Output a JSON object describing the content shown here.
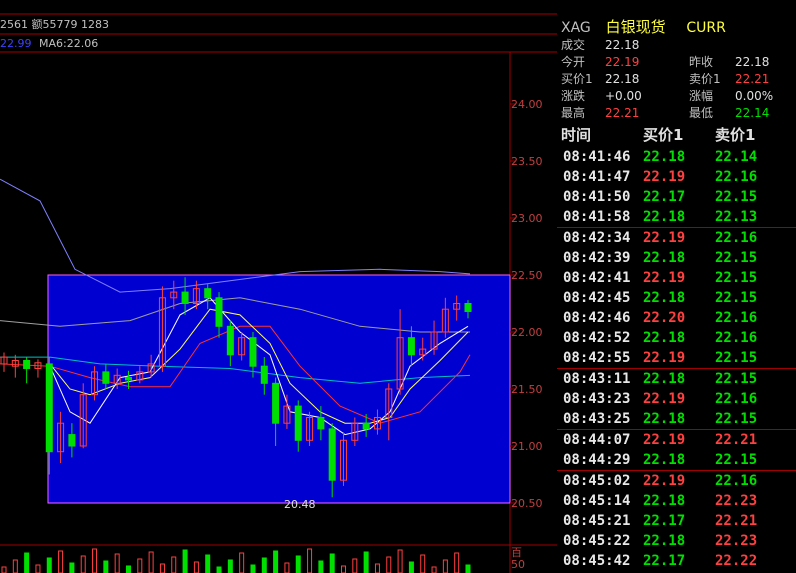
{
  "top_info": "2561 额55779 1283",
  "ma": {
    "ma5_label": "22.99",
    "ma6_label": "MA6:22.06"
  },
  "price_axis": [
    "24.00",
    "23.50",
    "23.00",
    "22.50",
    "22.00",
    "21.50",
    "21.00",
    "20.50"
  ],
  "low_marker": "20.48",
  "volume_axis": {
    "unit_label": "百",
    "value": "50"
  },
  "header": {
    "code": "XAG",
    "name": "白银现货",
    "tag": "CURR"
  },
  "quote": {
    "rows": [
      {
        "l1": "成交",
        "v1": "22.18",
        "c1": "w"
      },
      {
        "l1": "今开",
        "v1": "22.19",
        "c1": "r",
        "l2": "昨收",
        "v2": "22.18",
        "c2": "w"
      },
      {
        "l1": "买价1",
        "v1": "22.18",
        "c1": "w",
        "l2": "卖价1",
        "v2": "22.21",
        "c2": "r"
      },
      {
        "l1": "涨跌",
        "v1": "+0.00",
        "c1": "w",
        "l2": "涨幅",
        "v2": "0.00%",
        "c2": "w"
      },
      {
        "l1": "最高",
        "v1": "22.21",
        "c1": "r",
        "l2": "最低",
        "v2": "22.14",
        "c2": "g"
      }
    ]
  },
  "ticks_header": {
    "time": "时间",
    "bid": "买价1",
    "ask": "卖价1"
  },
  "ticks": [
    {
      "t": "08:41:46",
      "b": "22.18",
      "bc": "g",
      "s": "22.14",
      "sc": "g"
    },
    {
      "t": "08:41:47",
      "b": "22.19",
      "bc": "r",
      "s": "22.16",
      "sc": "g"
    },
    {
      "t": "08:41:50",
      "b": "22.17",
      "bc": "g",
      "s": "22.15",
      "sc": "g"
    },
    {
      "t": "08:41:58",
      "b": "22.18",
      "bc": "g",
      "s": "22.13",
      "sc": "g",
      "sep": true
    },
    {
      "t": "08:42:34",
      "b": "22.19",
      "bc": "r",
      "s": "22.16",
      "sc": "g"
    },
    {
      "t": "08:42:39",
      "b": "22.18",
      "bc": "g",
      "s": "22.15",
      "sc": "g"
    },
    {
      "t": "08:42:41",
      "b": "22.19",
      "bc": "r",
      "s": "22.15",
      "sc": "g"
    },
    {
      "t": "08:42:45",
      "b": "22.18",
      "bc": "g",
      "s": "22.15",
      "sc": "g"
    },
    {
      "t": "08:42:46",
      "b": "22.20",
      "bc": "r",
      "s": "22.16",
      "sc": "g"
    },
    {
      "t": "08:42:52",
      "b": "22.18",
      "bc": "g",
      "s": "22.16",
      "sc": "g"
    },
    {
      "t": "08:42:55",
      "b": "22.19",
      "bc": "r",
      "s": "22.15",
      "sc": "g",
      "sep": true
    },
    {
      "t": "08:43:11",
      "b": "22.18",
      "bc": "g",
      "s": "22.15",
      "sc": "g"
    },
    {
      "t": "08:43:23",
      "b": "22.19",
      "bc": "r",
      "s": "22.16",
      "sc": "g"
    },
    {
      "t": "08:43:25",
      "b": "22.18",
      "bc": "g",
      "s": "22.15",
      "sc": "g",
      "sep": true
    },
    {
      "t": "08:44:07",
      "b": "22.19",
      "bc": "r",
      "s": "22.21",
      "sc": "r"
    },
    {
      "t": "08:44:29",
      "b": "22.18",
      "bc": "g",
      "s": "22.15",
      "sc": "g",
      "sep": true
    },
    {
      "t": "08:45:02",
      "b": "22.19",
      "bc": "r",
      "s": "22.16",
      "sc": "g"
    },
    {
      "t": "08:45:14",
      "b": "22.18",
      "bc": "g",
      "s": "22.23",
      "sc": "r"
    },
    {
      "t": "08:45:21",
      "b": "22.17",
      "bc": "g",
      "s": "22.21",
      "sc": "r"
    },
    {
      "t": "08:45:22",
      "b": "22.18",
      "bc": "g",
      "s": "22.23",
      "sc": "r"
    },
    {
      "t": "08:45:42",
      "b": "22.17",
      "bc": "g",
      "s": "22.22",
      "sc": "r"
    }
  ],
  "colors": {
    "up": "#ff4040",
    "down": "#00e000",
    "box": "#0000d0",
    "grid": "#a00000"
  }
}
